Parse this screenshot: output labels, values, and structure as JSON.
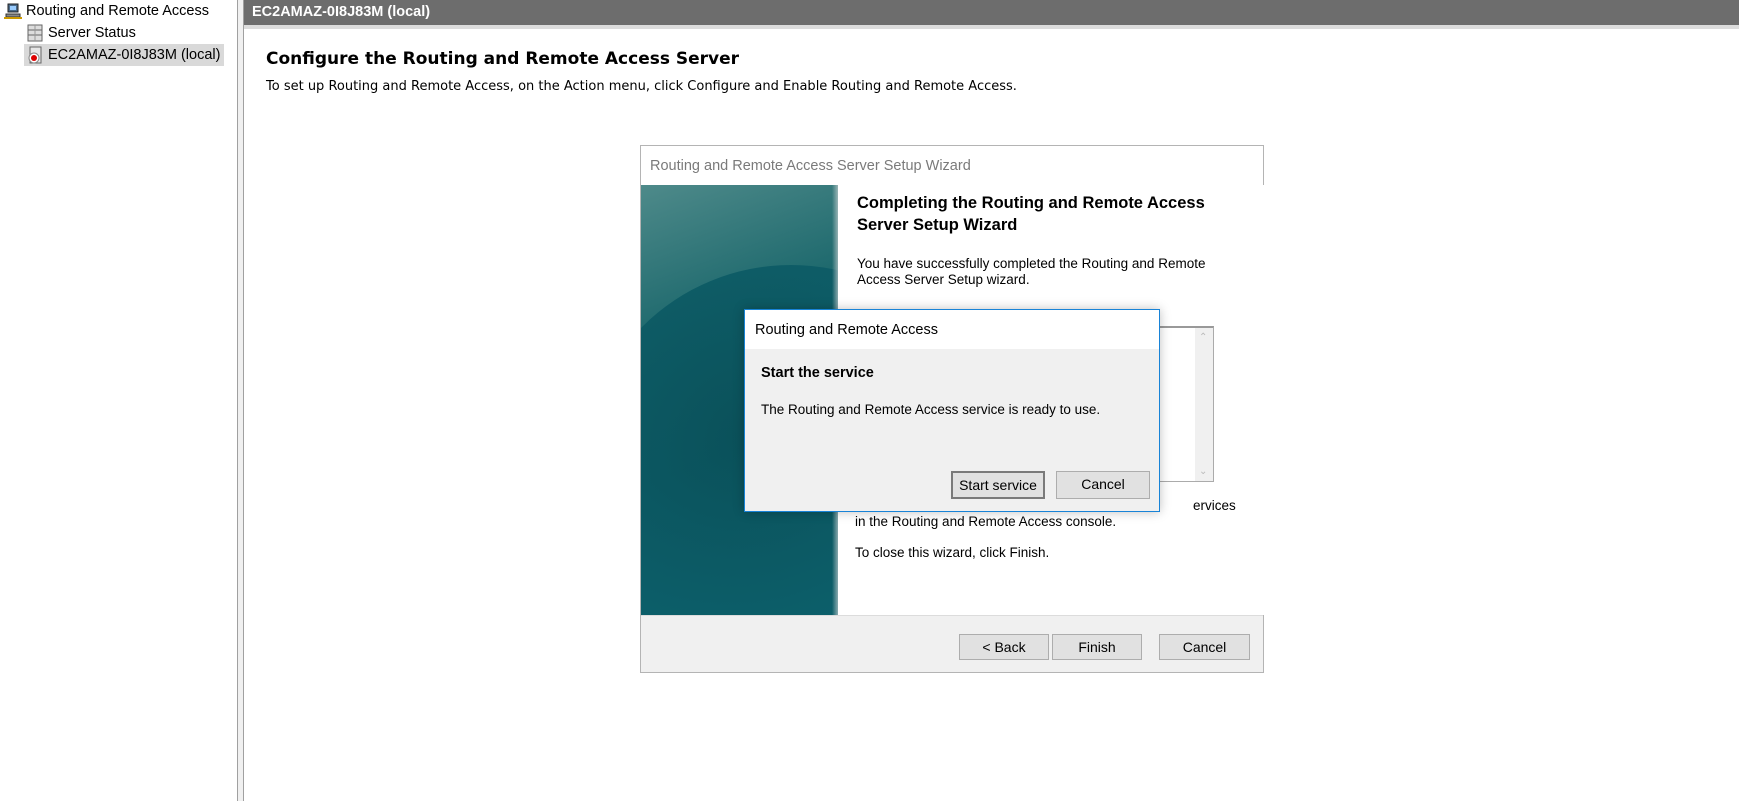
{
  "tree": {
    "root": "Routing and Remote Access",
    "items": [
      {
        "label": "Server Status",
        "icon": "server-status-icon"
      },
      {
        "label": "EC2AMAZ-0I8J83M (local)",
        "icon": "server-stopped-icon"
      }
    ]
  },
  "header": {
    "title": "EC2AMAZ-0I8J83M (local)"
  },
  "main": {
    "title": "Configure the Routing and Remote Access Server",
    "subtitle": "To set up Routing and Remote Access, on the Action menu, click Configure and Enable Routing and Remote Access."
  },
  "wizard": {
    "title": "Routing and Remote Access Server Setup Wizard",
    "heading": "Completing the Routing and Remote Access Server Setup Wizard",
    "success_text": "You have successfully completed the Routing and Remote Access Server Setup wizard.",
    "partial_text": "ervices",
    "console_text": "in the Routing and  Remote Access console.",
    "close_text": "To close this wizard, click Finish.",
    "buttons": {
      "back": "< Back",
      "finish": "Finish",
      "cancel": "Cancel"
    }
  },
  "popup": {
    "title": "Routing and Remote Access",
    "heading": "Start the service",
    "message": "The Routing and Remote Access service is ready to use.",
    "buttons": {
      "start": "Start service",
      "cancel": "Cancel"
    }
  }
}
